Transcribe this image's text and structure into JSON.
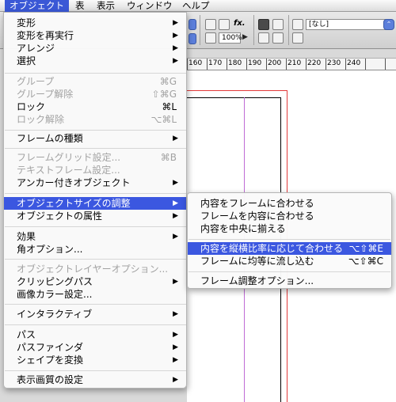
{
  "menubar": {
    "items": [
      {
        "label": "オブジェクト",
        "active": true
      },
      {
        "label": "表",
        "active": false
      },
      {
        "label": "表示",
        "active": false
      },
      {
        "label": "ウィンドウ",
        "active": false
      },
      {
        "label": "ヘルプ",
        "active": false
      }
    ]
  },
  "toolbar": {
    "zoom_value": "100%",
    "style_select_value": "[なし]",
    "fx_label": "fx."
  },
  "ruler": {
    "labels": [
      "160",
      "170",
      "180",
      "190",
      "200",
      "210",
      "220",
      "230",
      "240"
    ]
  },
  "menu": {
    "items": [
      {
        "label": "変形",
        "shortcut": "",
        "submenu": true,
        "disabled": false
      },
      {
        "label": "変形を再実行",
        "shortcut": "",
        "submenu": true,
        "disabled": false
      },
      {
        "label": "アレンジ",
        "shortcut": "",
        "submenu": true,
        "disabled": false
      },
      {
        "label": "選択",
        "shortcut": "",
        "submenu": true,
        "disabled": false
      },
      {
        "label": "グループ",
        "shortcut": "⌘G",
        "submenu": false,
        "disabled": true
      },
      {
        "label": "グループ解除",
        "shortcut": "⇧⌘G",
        "submenu": false,
        "disabled": true
      },
      {
        "label": "ロック",
        "shortcut": "⌘L",
        "submenu": false,
        "disabled": false
      },
      {
        "label": "ロック解除",
        "shortcut": "⌥⌘L",
        "submenu": false,
        "disabled": true
      },
      {
        "label": "フレームの種類",
        "shortcut": "",
        "submenu": true,
        "disabled": false
      },
      {
        "label": "フレームグリッド設定...",
        "shortcut": "⌘B",
        "submenu": false,
        "disabled": true
      },
      {
        "label": "テキストフレーム設定...",
        "shortcut": "",
        "submenu": false,
        "disabled": true
      },
      {
        "label": "アンカー付きオブジェクト",
        "shortcut": "",
        "submenu": true,
        "disabled": false
      },
      {
        "label": "オブジェクトサイズの調整",
        "shortcut": "",
        "submenu": true,
        "disabled": false,
        "highlighted": true
      },
      {
        "label": "オブジェクトの属性",
        "shortcut": "",
        "submenu": true,
        "disabled": false
      },
      {
        "label": "効果",
        "shortcut": "",
        "submenu": true,
        "disabled": false
      },
      {
        "label": "角オプション...",
        "shortcut": "",
        "submenu": false,
        "disabled": false
      },
      {
        "label": "オブジェクトレイヤーオプション...",
        "shortcut": "",
        "submenu": false,
        "disabled": true
      },
      {
        "label": "クリッピングパス",
        "shortcut": "",
        "submenu": true,
        "disabled": false
      },
      {
        "label": "画像カラー設定...",
        "shortcut": "",
        "submenu": false,
        "disabled": false
      },
      {
        "label": "インタラクティブ",
        "shortcut": "",
        "submenu": true,
        "disabled": false
      },
      {
        "label": "パス",
        "shortcut": "",
        "submenu": true,
        "disabled": false
      },
      {
        "label": "パスファインダ",
        "shortcut": "",
        "submenu": true,
        "disabled": false
      },
      {
        "label": "シェイプを変換",
        "shortcut": "",
        "submenu": true,
        "disabled": false
      },
      {
        "label": "表示画質の設定",
        "shortcut": "",
        "submenu": true,
        "disabled": false
      }
    ]
  },
  "submenu": {
    "items": [
      {
        "label": "内容をフレームに合わせる",
        "shortcut": ""
      },
      {
        "label": "フレームを内容に合わせる",
        "shortcut": ""
      },
      {
        "label": "内容を中央に揃える",
        "shortcut": ""
      },
      {
        "label": "内容を縦横比率に応じて合わせる",
        "shortcut": "⌥⇧⌘E",
        "highlighted": true
      },
      {
        "label": "フレームに均等に流し込む",
        "shortcut": "⌥⇧⌘C"
      },
      {
        "label": "フレーム調整オプション...",
        "shortcut": ""
      }
    ]
  },
  "colors": {
    "highlight": "#3b57e0",
    "margin_guide": "#c06bd6",
    "bleed_guide": "#e23a3a"
  }
}
